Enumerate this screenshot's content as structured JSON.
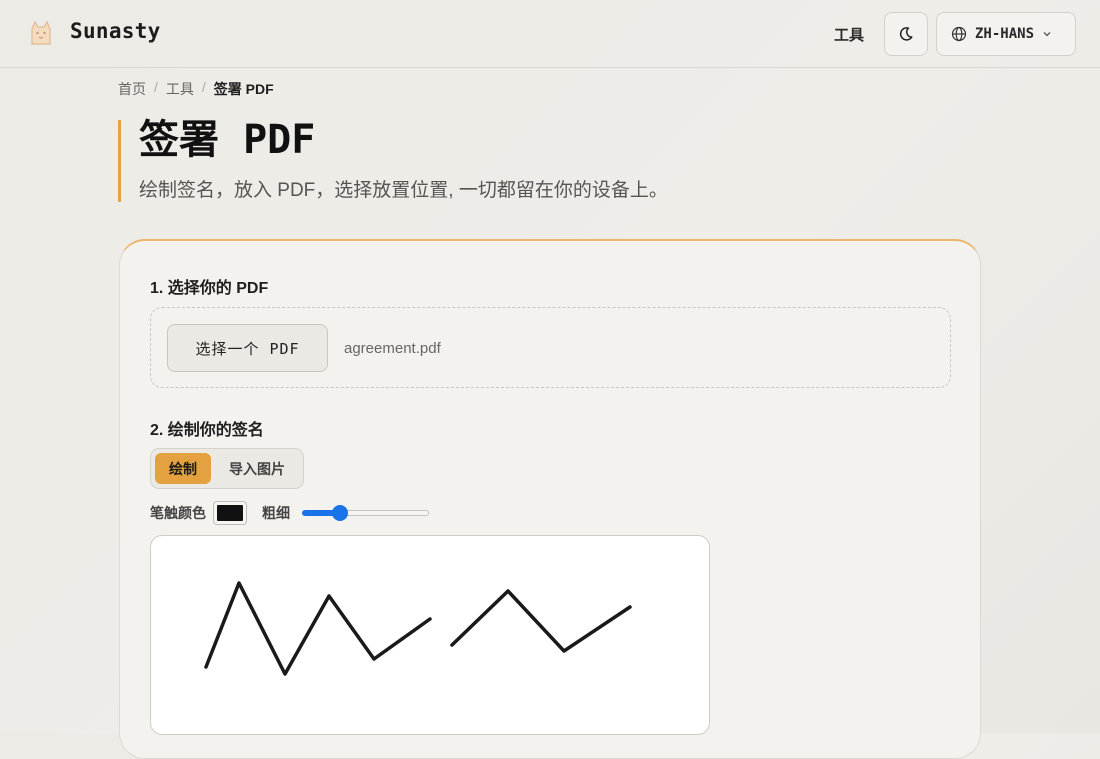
{
  "header": {
    "brand": "Sunasty",
    "nav_tools": "工具",
    "language": "ZH-HANS"
  },
  "breadcrumb": {
    "home": "首页",
    "tools": "工具",
    "current": "签署 PDF"
  },
  "page": {
    "title": "签署 PDF",
    "subtitle": "绘制签名，放入 PDF，选择放置位置, 一切都留在你的设备上。"
  },
  "step1": {
    "label": "1. 选择你的 PDF",
    "choose_button": "选择一个 PDF",
    "file_name": "agreement.pdf"
  },
  "step2": {
    "label": "2. 绘制你的签名",
    "modes": [
      "绘制",
      "导入图片"
    ],
    "active_mode": "绘制",
    "stroke_color_label": "笔触颜色",
    "stroke_color": "#111111",
    "stroke_width_label": "粗细",
    "stroke_width_fraction": 0.27
  },
  "colors": {
    "accent": "#e3a23f",
    "slider": "#1a73e8"
  }
}
